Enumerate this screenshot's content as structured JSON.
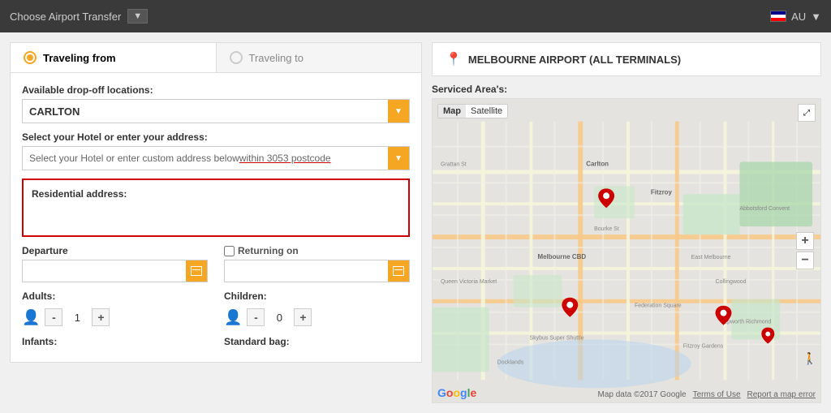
{
  "topbar": {
    "dropdown_label": "Choose Airport Transfer",
    "region_label": "AU"
  },
  "tabs": [
    {
      "id": "from",
      "label": "Traveling from",
      "active": true
    },
    {
      "id": "to",
      "label": "Traveling to",
      "active": false
    }
  ],
  "destination": {
    "pin_icon": "📍",
    "title": "MELBOURNE AIRPORT (ALL TERMINALS)"
  },
  "form": {
    "available_dropoff_label": "Available drop-off locations:",
    "available_dropoff_value": "CARLTON",
    "hotel_label": "Select your Hotel or enter your address:",
    "hotel_placeholder": "Select your Hotel or enter custom address below within 3053 postcode",
    "residential_label": "Residential address:",
    "departure_label": "Departure",
    "returning_label": "Returning on",
    "adults_label": "Adults:",
    "adults_value": "1",
    "children_label": "Children:",
    "children_value": "0",
    "infants_label": "Infants:",
    "standard_bag_label": "Standard bag:"
  },
  "map": {
    "serviced_areas_label": "Serviced Area's:",
    "map_tab_map": "Map",
    "map_tab_satellite": "Satellite",
    "footer_data": "Map data ©2017 Google",
    "footer_terms": "Terms of Use",
    "footer_report": "Report a map error",
    "zoom_in": "+",
    "zoom_out": "−",
    "expand_icon": "⤢"
  }
}
